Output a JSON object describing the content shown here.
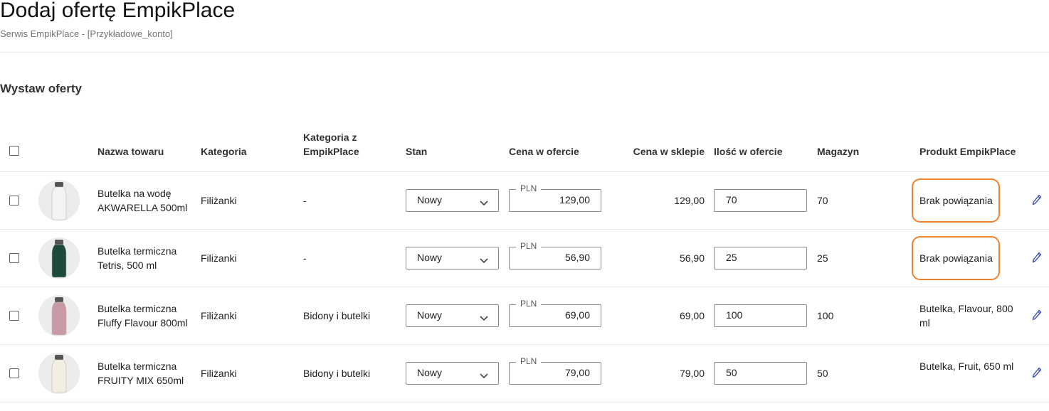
{
  "page": {
    "title": "Dodaj ofertę EmpikPlace",
    "subtitle": "Serwis EmpikPlace - [Przykładowe_konto]",
    "section_title": "Wystaw oferty"
  },
  "table": {
    "headers": {
      "name": "Nazwa towaru",
      "category": "Kategoria",
      "empik_category": "Kategoria z EmpikPlace",
      "condition": "Stan",
      "offer_price": "Cena w ofercie",
      "store_price": "Cena w sklepie",
      "offer_quantity": "Ilość w ofercie",
      "warehouse": "Magazyn",
      "empik_product": "Produkt EmpikPlace"
    },
    "rows": [
      {
        "name": "Butelka na wodę AKWARELLA 500ml",
        "category": "Filiżanki",
        "empik_category": "-",
        "condition": "Nowy",
        "currency": "PLN",
        "offer_price": "129,00",
        "store_price": "129,00",
        "quantity": "70",
        "warehouse": "70",
        "empik_product": "Brak powiązania",
        "highlighted": true,
        "bottle_color": "#f3f3f3",
        "icon": "pencil-icon"
      },
      {
        "name": "Butelka termiczna Tetris, 500 ml",
        "category": "Filiżanki",
        "empik_category": "-",
        "condition": "Nowy",
        "currency": "PLN",
        "offer_price": "56,90",
        "store_price": "56,90",
        "quantity": "25",
        "warehouse": "25",
        "empik_product": "Brak powiązania",
        "highlighted": true,
        "bottle_color": "#1e4a3c",
        "icon": "pencil-icon"
      },
      {
        "name": "Butelka termiczna Fluffy Flavour 800ml",
        "category": "Filiżanki",
        "empik_category": "Bidony i butelki",
        "condition": "Nowy",
        "currency": "PLN",
        "offer_price": "69,00",
        "store_price": "69,00",
        "quantity": "100",
        "warehouse": "100",
        "empik_product": "Butelka, Flavour, 800 ml",
        "highlighted": false,
        "bottle_color": "#c99aa6",
        "icon": "pencil-icon"
      },
      {
        "name": "Butelka termiczna FRUITY MIX 650ml",
        "category": "Filiżanki",
        "empik_category": "Bidony i butelki",
        "condition": "Nowy",
        "currency": "PLN",
        "offer_price": "79,00",
        "store_price": "79,00",
        "quantity": "50",
        "warehouse": "50",
        "empik_product": "Butelka, Fruit, 650 ml",
        "highlighted": false,
        "bottle_color": "#f2eee2",
        "icon": "pencil-icon"
      }
    ]
  },
  "colors": {
    "highlight": "#f0822c",
    "edit_icon": "#3f51b5"
  }
}
